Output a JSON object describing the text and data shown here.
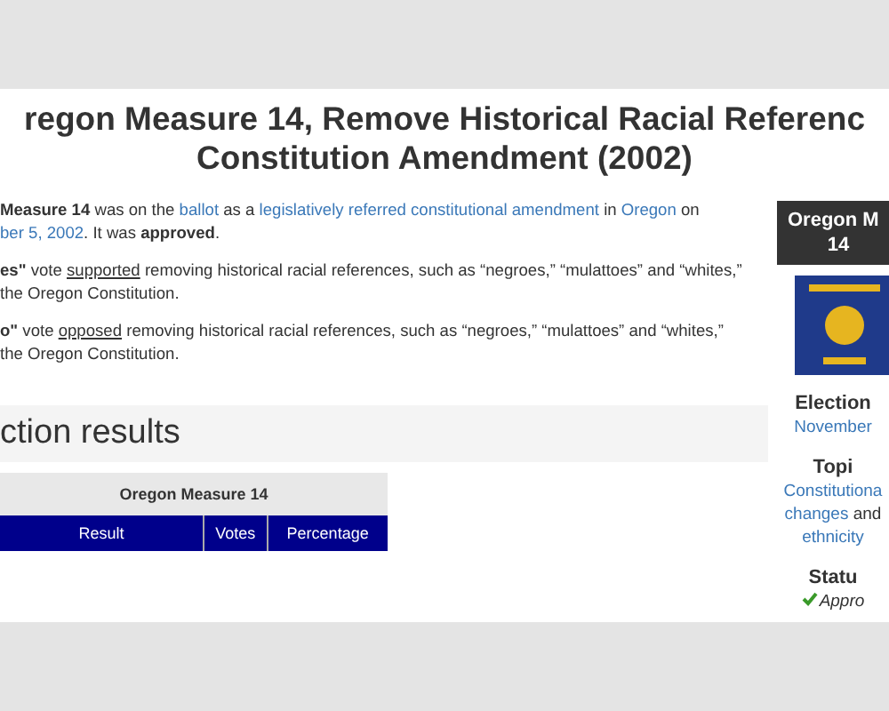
{
  "title": [
    "regon Measure 14, Remove Historical Racial Referenc",
    "Constitution Amendment (2002)"
  ],
  "paragraphs": [
    [
      {
        "kind": "bold",
        "text": "Measure 14"
      },
      {
        "kind": "plain",
        "text": " was on the "
      },
      {
        "kind": "link",
        "text": "ballot"
      },
      {
        "kind": "plain",
        "text": " as a "
      },
      {
        "kind": "link",
        "text": "legislatively referred constitutional amendment"
      },
      {
        "kind": "plain",
        "text": " in "
      },
      {
        "kind": "link",
        "text": "Oregon"
      },
      {
        "kind": "plain",
        "text": " on"
      },
      {
        "kind": "break"
      },
      {
        "kind": "link",
        "text": "ber 5, 2002"
      },
      {
        "kind": "plain",
        "text": ". It was "
      },
      {
        "kind": "bold",
        "text": "approved"
      },
      {
        "kind": "plain",
        "text": "."
      }
    ],
    [
      {
        "kind": "bold",
        "text": "es\""
      },
      {
        "kind": "plain",
        "text": " vote "
      },
      {
        "kind": "underline",
        "text": "supported"
      },
      {
        "kind": "plain",
        "text": " removing historical racial references, such as “negroes,” “mulattoes” and “whites,”"
      },
      {
        "kind": "break"
      },
      {
        "kind": "plain",
        "text": "the Oregon Constitution."
      }
    ],
    [
      {
        "kind": "bold",
        "text": "o\""
      },
      {
        "kind": "plain",
        "text": " vote "
      },
      {
        "kind": "underline",
        "text": "opposed"
      },
      {
        "kind": "plain",
        "text": " removing historical racial references, such as “negroes,” “mulattoes” and “whites,”"
      },
      {
        "kind": "break"
      },
      {
        "kind": "plain",
        "text": "the Oregon Constitution."
      }
    ]
  ],
  "section_heading": "ction results",
  "results_table": {
    "caption": "Oregon Measure 14",
    "columns": [
      "Result",
      "Votes",
      "Percentage"
    ]
  },
  "infobox": {
    "header": [
      "Oregon M",
      "14"
    ],
    "items": [
      {
        "kind": "heading",
        "text": "Election"
      },
      {
        "kind": "line",
        "segments": [
          {
            "kind": "link",
            "text": "November"
          }
        ]
      },
      {
        "kind": "heading",
        "text": "Topi"
      },
      {
        "kind": "line",
        "segments": [
          {
            "kind": "link",
            "text": "Constitutiona"
          }
        ]
      },
      {
        "kind": "line",
        "segments": [
          {
            "kind": "link",
            "text": "changes"
          },
          {
            "kind": "plain",
            "text": " and"
          }
        ]
      },
      {
        "kind": "line",
        "segments": [
          {
            "kind": "link",
            "text": "ethnicity"
          }
        ]
      },
      {
        "kind": "heading",
        "text": "Statu"
      },
      {
        "kind": "status",
        "text": "Appro"
      }
    ]
  }
}
